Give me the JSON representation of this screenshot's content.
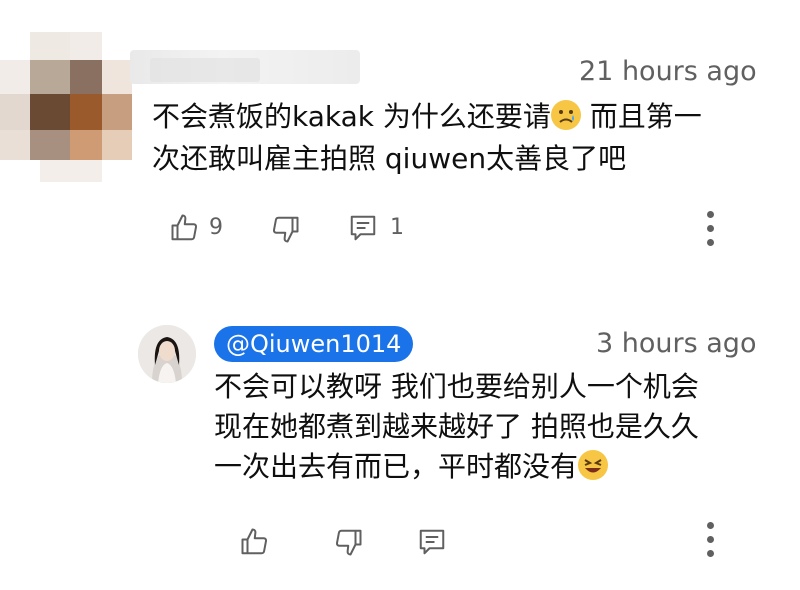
{
  "comment": {
    "timestamp": "21 hours ago",
    "text_line1": "不会煮饭的kakak 为什么还要请",
    "emoji1": "😢",
    "text_line1_cont": " 而且第一",
    "text_line2": "次还敢叫雇主拍照 qiuwen太善良了吧",
    "like_count": "9",
    "reply_count": "1"
  },
  "reply": {
    "author": "@Qiuwen1014",
    "timestamp": "3 hours ago",
    "line1": "不会可以教呀 我们也要给别人一个机会",
    "line2": "现在她都煮到越来越好了 拍照也是久久",
    "line3": "一次出去有而已，平时都没有",
    "emoji": "😆"
  },
  "colors": {
    "mention_bg": "#1a73e8",
    "meta_text": "#606060",
    "icon": "#606060"
  },
  "icons": [
    "thumb-up-icon",
    "thumb-down-icon",
    "reply-icon",
    "more-vert-icon",
    "avatar",
    "pixelated-avatar"
  ]
}
